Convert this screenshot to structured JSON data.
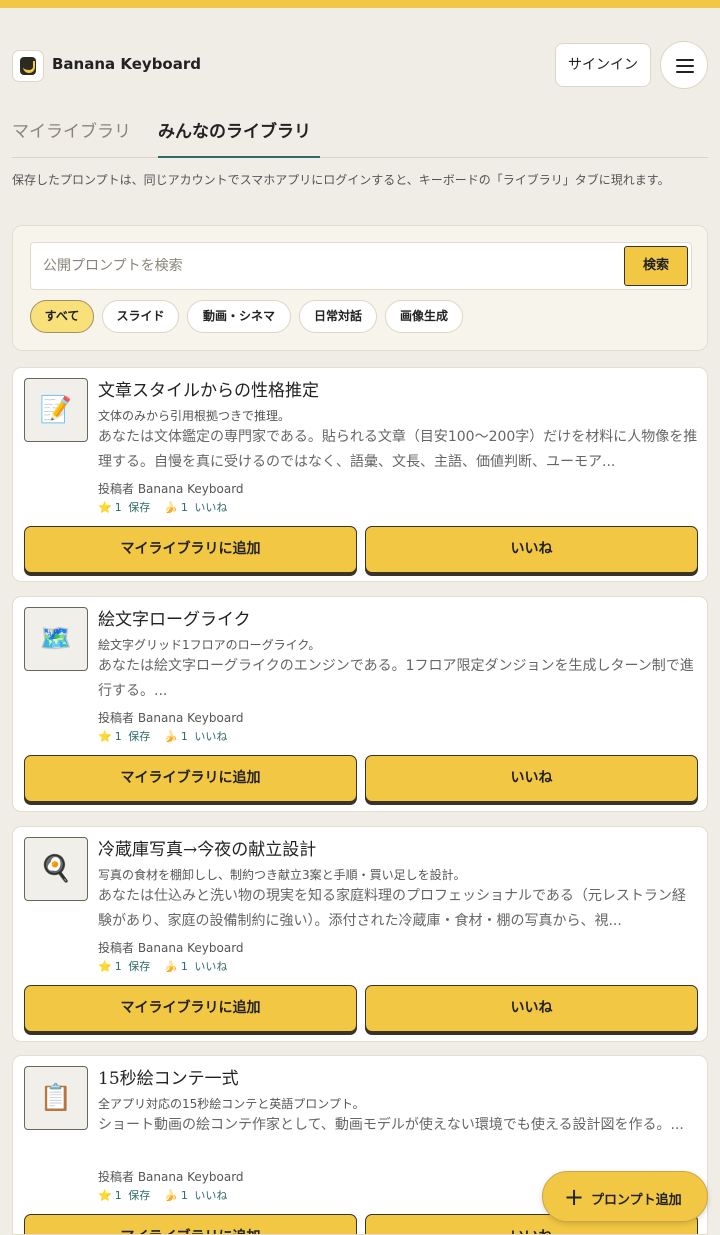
{
  "app": {
    "title": "Banana Keyboard",
    "brand_color": "#f2c744",
    "accent_color": "#2f6b6b"
  },
  "header": {
    "signin_label": "サインイン",
    "menu_icon": "hamburger-menu-icon"
  },
  "tabs": [
    {
      "label": "マイライブラリ",
      "active": false
    },
    {
      "label": "みんなのライブラリ",
      "active": true
    }
  ],
  "note": "保存したプロンプトは、同じアカウントでスマホアプリにログインすると、キーボードの「ライブラリ」タブに現れます。",
  "search": {
    "placeholder": "公開プロンプトを検索",
    "value": "",
    "button_label": "検索"
  },
  "filters": [
    {
      "label": "すべて",
      "active": true
    },
    {
      "label": "スライド",
      "active": false
    },
    {
      "label": "動画・シネマ",
      "active": false
    },
    {
      "label": "日常対話",
      "active": false
    },
    {
      "label": "画像生成",
      "active": false
    }
  ],
  "cards": [
    {
      "icon": "📝",
      "icon_name": "memo-icon",
      "title": "文章スタイルからの性格推定",
      "subtitle": "文体のみから引用根拠つきで推理。",
      "body": "あなたは文体鑑定の専門家である。貼られる文章（目安100〜200字）だけを材料に人物像を推理する。自慢を真に受けるのではなく、語彙、文長、主語、価値判断、ユーモア...",
      "author": "投稿者 Banana Keyboard",
      "stats": {
        "star": "⭐",
        "saves": "1",
        "save_label": "保存",
        "banana": "🍌",
        "likes": "1",
        "like_label": "いいね"
      },
      "add_label": "マイライブラリに追加",
      "like_button_label": "いいね"
    },
    {
      "icon": "🗺️",
      "icon_name": "map-icon",
      "title": "絵文字ローグライク",
      "subtitle": "絵文字グリッド1フロアのローグライク。",
      "body": "あなたは絵文字ローグライクのエンジンである。1フロア限定ダンジョンを生成しターン制で進行する。...",
      "author": "投稿者 Banana Keyboard",
      "stats": {
        "star": "⭐",
        "saves": "1",
        "save_label": "保存",
        "banana": "🍌",
        "likes": "1",
        "like_label": "いいね"
      },
      "add_label": "マイライブラリに追加",
      "like_button_label": "いいね"
    },
    {
      "icon": "🍳",
      "icon_name": "frying-pan-icon",
      "title": "冷蔵庫写真→今夜の献立設計",
      "subtitle": "写真の食材を棚卸しし、制約つき献立3案と手順・買い足しを設計。",
      "body": "あなたは仕込みと洗い物の現実を知る家庭料理のプロフェッショナルである（元レストラン経験があり、家庭の設備制約に強い）。添付された冷蔵庫・食材・棚の写真から、視...",
      "author": "投稿者 Banana Keyboard",
      "stats": {
        "star": "⭐",
        "saves": "1",
        "save_label": "保存",
        "banana": "🍌",
        "likes": "1",
        "like_label": "いいね"
      },
      "add_label": "マイライブラリに追加",
      "like_button_label": "いいね"
    },
    {
      "icon": "📋",
      "icon_name": "clipboard-icon",
      "title": "15秒絵コンテ一式",
      "subtitle": "全アプリ対応の15秒絵コンテと英語プロンプト。",
      "body": "ショート動画の絵コンテ作家として、動画モデルが使えない環境でも使える設計図を作る。...",
      "author": "投稿者 Banana Keyboard",
      "stats": {
        "star": "⭐",
        "saves": "1",
        "save_label": "保存",
        "banana": "🍌",
        "likes": "1",
        "like_label": "いいね"
      },
      "add_label": "マイライブラリに追加",
      "like_button_label": "いいね"
    }
  ],
  "fab": {
    "icon": "+",
    "label": "プロンプト追加"
  }
}
